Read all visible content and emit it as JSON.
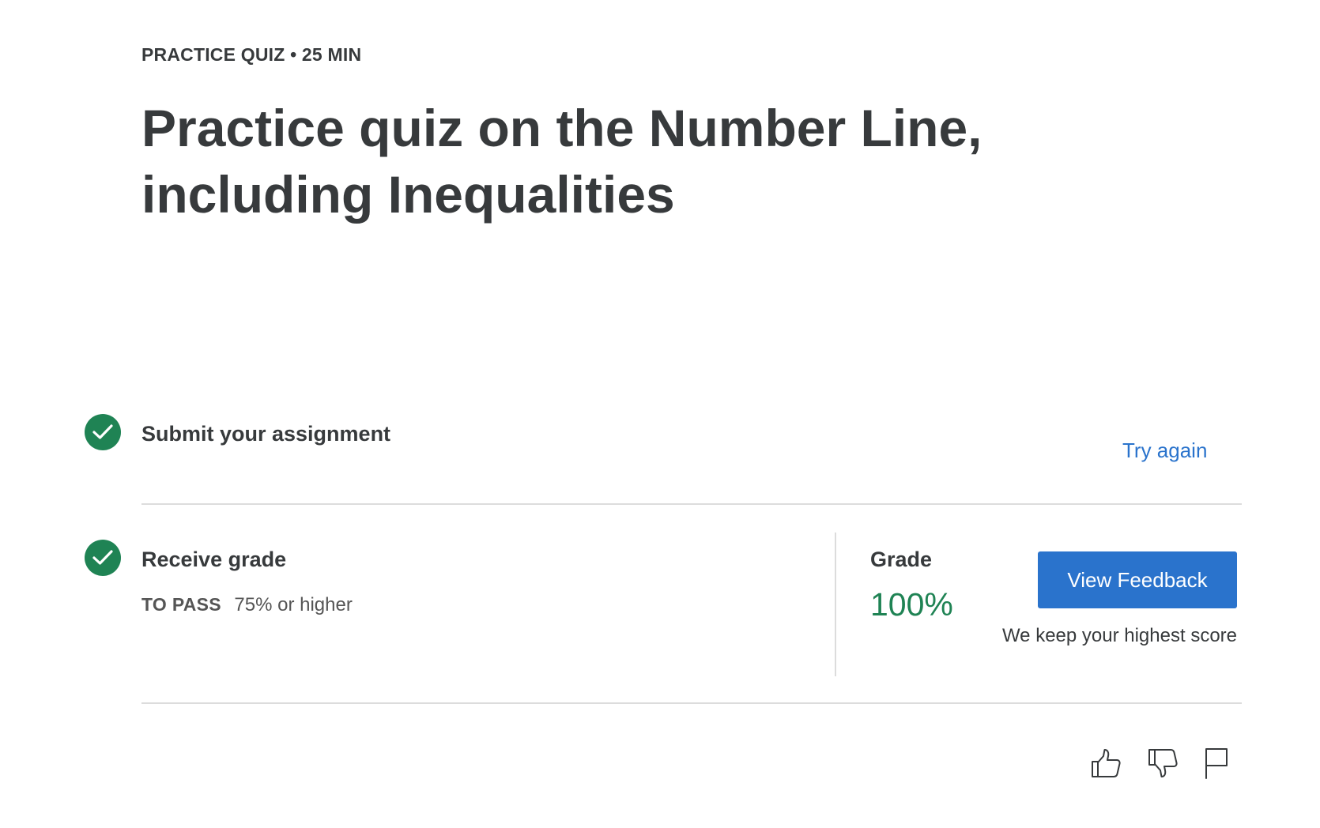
{
  "header": {
    "eyebrow": "PRACTICE QUIZ • 25 MIN",
    "title": "Practice quiz on the Number Line, including Inequalities"
  },
  "steps": [
    {
      "title": "Submit your assignment",
      "action_label": "Try again",
      "status": "complete"
    },
    {
      "title": "Receive grade",
      "to_pass_label": "TO PASS",
      "to_pass_value": "75% or higher",
      "status": "complete"
    }
  ],
  "grade": {
    "label": "Grade",
    "value": "100%",
    "button_label": "View Feedback",
    "note": "We keep your highest score"
  },
  "icons": [
    "thumbs-up-icon",
    "thumbs-down-icon",
    "flag-icon"
  ],
  "colors": {
    "success": "#1f8354",
    "primary": "#2a73cc",
    "text": "#373a3c",
    "divider": "#dcdcdc"
  }
}
